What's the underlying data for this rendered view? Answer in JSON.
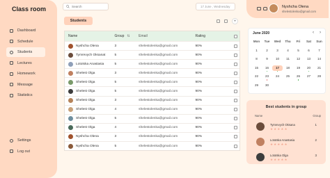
{
  "app": {
    "title": "Class room"
  },
  "sidebar": {
    "items": [
      {
        "label": "Dashboard",
        "icon": "grid-icon",
        "active": false
      },
      {
        "label": "Schedule",
        "icon": "calendar-icon",
        "active": false
      },
      {
        "label": "Students",
        "icon": "users-icon",
        "active": true
      },
      {
        "label": "Lectures",
        "icon": "book-icon",
        "active": false
      },
      {
        "label": "Homework",
        "icon": "pencil-icon",
        "active": false
      },
      {
        "label": "Message",
        "icon": "mail-icon",
        "active": false
      },
      {
        "label": "Statistics",
        "icon": "chart-icon",
        "active": false
      }
    ],
    "bottom": [
      {
        "label": "Settings",
        "icon": "gear-icon"
      },
      {
        "label": "Log out",
        "icon": "logout-icon"
      }
    ]
  },
  "search": {
    "placeholder": "Search"
  },
  "date_pill": "17 June , Wednesday",
  "students_tab": "Students",
  "add_label": "+",
  "table": {
    "headers": {
      "name": "Name",
      "group": "Group",
      "email": "Email",
      "rating": "Rating"
    },
    "rows": [
      {
        "name": "Nyshcha Olena",
        "group": "3",
        "email": "shelestolenka@gmail.com",
        "rating": "90%",
        "avatar_color": "#a0522d"
      },
      {
        "name": "Tymrevych Oksanat",
        "group": "5",
        "email": "shelestolenka@gmail.com",
        "rating": "90%",
        "avatar_color": "#6b4c3b"
      },
      {
        "name": "Lototska Anastasia",
        "group": "5",
        "email": "shelestolenka@gmail.com",
        "rating": "90%",
        "avatar_color": "#8f9fb8"
      },
      {
        "name": "Shelest Olga",
        "group": "3",
        "email": "shelestolenka@gmail.com",
        "rating": "90%",
        "avatar_color": "#c08060"
      },
      {
        "name": "Shelest Olga",
        "group": "5",
        "email": "shelestolenka@gmail.com",
        "rating": "90%",
        "avatar_color": "#7a9a6a"
      },
      {
        "name": "Shelest Olga",
        "group": "5",
        "email": "shelestolenka@gmail.com",
        "rating": "90%",
        "avatar_color": "#3d3d3d"
      },
      {
        "name": "Shelest Olga",
        "group": "3",
        "email": "shelestolenka@gmail.com",
        "rating": "90%",
        "avatar_color": "#b5835a"
      },
      {
        "name": "Shelest Olga",
        "group": "4",
        "email": "shelestolenka@gmail.com",
        "rating": "90%",
        "avatar_color": "#c9a27a"
      },
      {
        "name": "Shelest Olga",
        "group": "5",
        "email": "shelestolenka@gmail.com",
        "rating": "90%",
        "avatar_color": "#6f8f9f"
      },
      {
        "name": "Shelest Olga",
        "group": "4",
        "email": "shelestolenka@gmail.com",
        "rating": "90%",
        "avatar_color": "#4a6a5a"
      },
      {
        "name": "Nyshcha Olena",
        "group": "3",
        "email": "shelestolenka@gmail.com",
        "rating": "90%",
        "avatar_color": "#a0522d"
      },
      {
        "name": "Nyshcha Olena",
        "group": "5",
        "email": "shelestolenka@gmail.com",
        "rating": "90%",
        "avatar_color": "#8a5a3a"
      }
    ]
  },
  "profile": {
    "name": "Nyshcha Olena",
    "email": "shelestolenka@gmail.com"
  },
  "calendar": {
    "title": "June 2020",
    "weekdays": [
      "Mon",
      "Tue",
      "Wed",
      "Thu",
      "Fri",
      "Sat",
      "Sun"
    ],
    "weeks": [
      [
        "1",
        "2",
        "3",
        "4",
        "5",
        "6",
        "7"
      ],
      [
        "8",
        "9",
        "10",
        "11",
        "12",
        "13",
        "14"
      ],
      [
        "15",
        "16",
        "17",
        "18",
        "19",
        "20",
        "21"
      ],
      [
        "22",
        "23",
        "24",
        "25",
        "26",
        "27",
        "28"
      ],
      [
        "29",
        "30",
        "",
        "",
        "",
        "",
        ""
      ]
    ],
    "selected": "17",
    "dots": {
      "16": "#4caf50",
      "17": "#4caf50",
      "20": "#4caf50",
      "23": "#e57373",
      "26": "#4caf50"
    }
  },
  "best": {
    "title": "Best students in group",
    "headers": {
      "name": "Name",
      "group": "Group"
    },
    "items": [
      {
        "name": "Tymrevych Oksana",
        "group": "1",
        "stars": "★★★★★",
        "avatar_color": "#6b4c3b"
      },
      {
        "name": "Lototska Anastasia",
        "group": "2",
        "stars": "★★★★★",
        "avatar_color": "#c08060"
      },
      {
        "name": "Lototska Olga",
        "group": "3",
        "stars": "★★★★★",
        "avatar_color": "#3d3d3d"
      }
    ]
  },
  "colors": {
    "sidebar": "#ffd9c2",
    "accent": "#ffd2bb",
    "table_header": "#e5f3e6",
    "page": "#fff6ec"
  }
}
